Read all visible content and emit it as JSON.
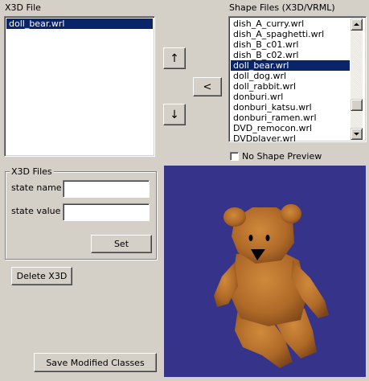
{
  "x3d_file": {
    "label": "X3D File",
    "items": [
      {
        "label": "doll_bear.wrl",
        "selected": true
      }
    ]
  },
  "shape_files": {
    "label": "Shape Files (X3D/VRML)",
    "items": [
      {
        "label": "dish_A_curry.wrl",
        "selected": false
      },
      {
        "label": "dish_A_spaghetti.wrl",
        "selected": false
      },
      {
        "label": "dish_B_c01.wrl",
        "selected": false
      },
      {
        "label": "dish_B_c02.wrl",
        "selected": false
      },
      {
        "label": "doll_bear.wrl",
        "selected": true
      },
      {
        "label": "doll_dog.wrl",
        "selected": false
      },
      {
        "label": "doll_rabbit.wrl",
        "selected": false
      },
      {
        "label": "donburi.wrl",
        "selected": false
      },
      {
        "label": "donburi_katsu.wrl",
        "selected": false
      },
      {
        "label": "donburi_ramen.wrl",
        "selected": false
      },
      {
        "label": "DVD_remocon.wrl",
        "selected": false
      },
      {
        "label": "DVDplayer.wrl",
        "selected": false
      }
    ],
    "scroll_thumb_fraction": 0.8
  },
  "buttons": {
    "move_up": "↑",
    "move_down": "↓",
    "add": "<",
    "set": "Set",
    "delete": "Delete X3D",
    "save": "Save Modified Classes"
  },
  "preview": {
    "no_preview_label": "No Shape Preview",
    "no_preview_checked": false,
    "background_color": "#35338a",
    "model_color": "#b8702a"
  },
  "x3d_files_group": {
    "title": "X3D Files",
    "state_name_label": "state name",
    "state_name_value": "",
    "state_value_label": "state value",
    "state_value_value": ""
  }
}
